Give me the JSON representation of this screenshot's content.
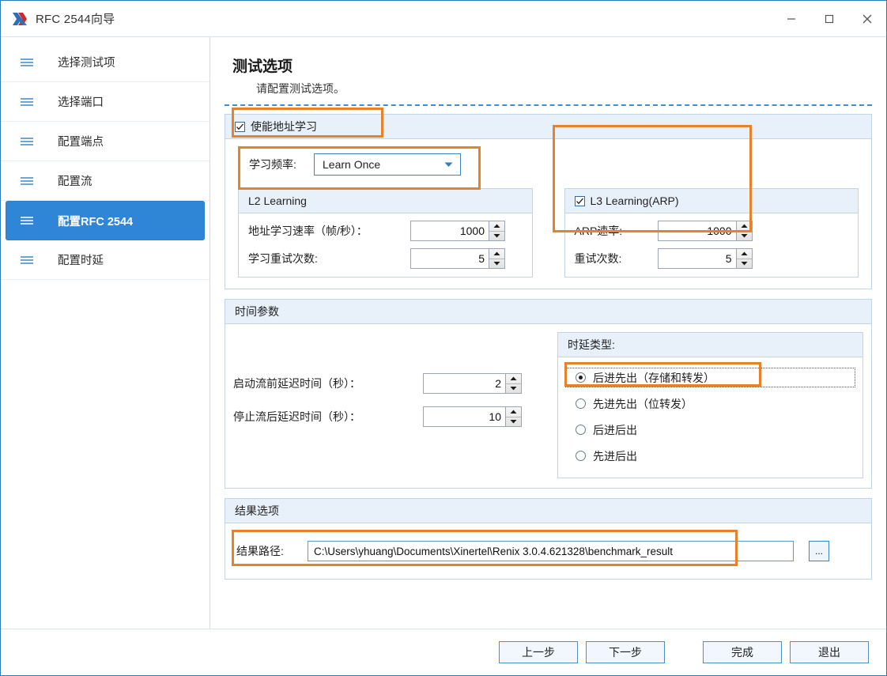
{
  "window": {
    "title": "RFC 2544向导",
    "logo_icon": "xinertel-x-logo",
    "controls": [
      {
        "name": "minimize-button",
        "icon": "minimize-icon"
      },
      {
        "name": "maximize-button",
        "icon": "maximize-icon"
      },
      {
        "name": "close-button",
        "icon": "close-icon"
      }
    ]
  },
  "sidebar": {
    "items": [
      {
        "label": "选择测试项",
        "icon": "hamburger-icon",
        "selected": false
      },
      {
        "label": "选择端口",
        "icon": "hamburger-icon",
        "selected": false
      },
      {
        "label": "配置端点",
        "icon": "hamburger-icon",
        "selected": false
      },
      {
        "label": "配置流",
        "icon": "hamburger-icon",
        "selected": false
      },
      {
        "label": "配置RFC 2544",
        "icon": "hamburger-icon",
        "selected": true
      },
      {
        "label": "配置时延",
        "icon": "hamburger-icon",
        "selected": false
      }
    ]
  },
  "page": {
    "title": "测试选项",
    "subtitle": "请配置测试选项。"
  },
  "address_learning": {
    "enable_label": "使能地址学习",
    "enabled": true,
    "frequency_label": "学习频率:",
    "frequency_value": "Learn Once",
    "l2": {
      "title": "L2 Learning",
      "rate_label": "地址学习速率（帧/秒）：",
      "rate_value": "1000",
      "retry_label": "学习重试次数:",
      "retry_value": "5"
    },
    "l3": {
      "title": "L3 Learning(ARP)",
      "enabled": true,
      "rate_label": "ARP速率:",
      "rate_value": "1000",
      "retry_label": "重试次数:",
      "retry_value": "5"
    }
  },
  "time_params": {
    "title": "时间参数",
    "start_delay_label": "启动流前延迟时间（秒）：",
    "start_delay_value": "2",
    "stop_delay_label": "停止流后延迟时间（秒）：",
    "stop_delay_value": "10",
    "latency_type_title": "时延类型:",
    "latency_options": [
      {
        "label": "后进先出（存储和转发）",
        "selected": true
      },
      {
        "label": "先进先出（位转发）",
        "selected": false
      },
      {
        "label": "后进后出",
        "selected": false
      },
      {
        "label": "先进后出",
        "selected": false
      }
    ]
  },
  "result_options": {
    "title": "结果选项",
    "path_label": "结果路径:",
    "path_value": "C:\\Users\\yhuang\\Documents\\Xinertel\\Renix 3.0.4.621328\\benchmark_result",
    "browse_label": "..."
  },
  "footer": {
    "prev_label": "上一步",
    "next_label": "下一步",
    "finish_label": "完成",
    "exit_label": "退出"
  },
  "colors": {
    "accent_blue": "#3086d6",
    "highlight_orange": "#e8822a",
    "group_header": "#e8f1f9",
    "dashed_separator": "#3f8fd0"
  }
}
